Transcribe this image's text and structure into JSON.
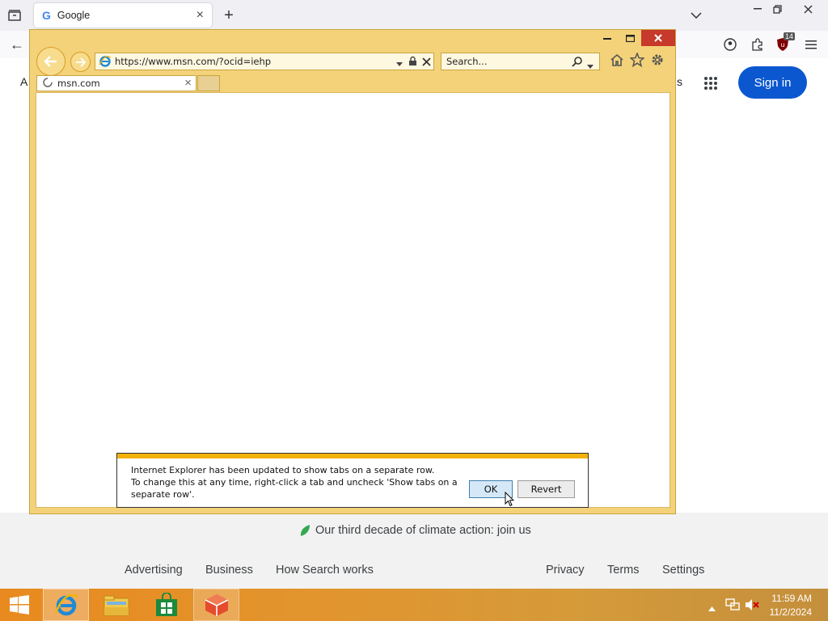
{
  "firefox": {
    "tab_title": "Google",
    "tab_close": "×",
    "new_tab": "+",
    "extension_badge": "14",
    "partial_left_text": "A",
    "partial_right_text": "s",
    "sign_in": "Sign in",
    "climate_text": "Our third decade of climate action: join us",
    "footer_left": [
      "Advertising",
      "Business",
      "How Search works"
    ],
    "footer_right": [
      "Privacy",
      "Terms",
      "Settings"
    ]
  },
  "ie": {
    "address_url": "https://www.msn.com/?ocid=iehp",
    "search_placeholder": "Search...",
    "tab_title": "msn.com",
    "tab_close": "×",
    "notification": {
      "line1": "Internet Explorer has been updated to show tabs on a separate row.",
      "line2": "To change this at any time, right-click a tab and uncheck 'Show tabs on a",
      "line3": "separate row'.",
      "ok_label": "OK",
      "revert_label": "Revert"
    }
  },
  "taskbar": {
    "time": "11:59 AM",
    "date": "11/2/2024"
  },
  "colors": {
    "ie_frame": "#f3d279",
    "ie_close": "#c7392a",
    "notify_stripe": "#f2b10c",
    "taskbar": "#e88a1f",
    "signin": "#0b57d0"
  }
}
